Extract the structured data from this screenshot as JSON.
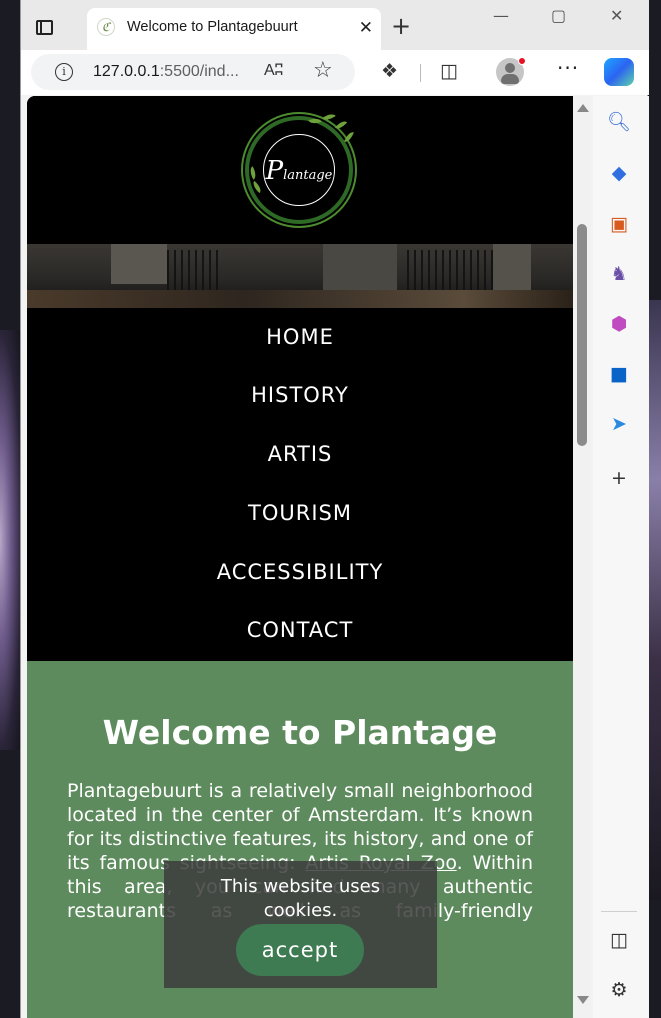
{
  "browser": {
    "tab_title": "Welcome to Plantagebuurt",
    "tab_favicon_glyph": "ℭ",
    "url_main": "127.0.0.1",
    "url_rest": ":5500/ind...",
    "read_aloud": "Aᶜ",
    "window_minimize": "—",
    "window_maximize": "▢",
    "window_close": "✕",
    "new_tab": "+",
    "tab_close": "✕",
    "more": "···"
  },
  "logo": {
    "brand_initial": "P",
    "brand_rest": "lantage"
  },
  "nav": {
    "items": [
      "HOME",
      "HISTORY",
      "ARTIS",
      "TOURISM",
      "ACCESSIBILITY",
      "CONTACT"
    ]
  },
  "welcome": {
    "title": "Welcome to Plantage",
    "text_before_link": "Plantagebuurt is a relatively small neighborhood located in the center of Amsterdam. It’s known for its distinctive features, its history, and one of its famous sightseeing: ",
    "link_text": "Artis Royal Zoo",
    "text_after_link": ". Within this area, you can find many authentic restaurants as well as family-friendly attractions."
  },
  "cookie": {
    "message": "This website uses cookies.",
    "button_label": "accept"
  },
  "colors": {
    "welcome_bg": "#5e8b5e",
    "accept_bg": "#3e7a52",
    "logo_green": "#4c8b2e"
  },
  "icons": {
    "sidebar": [
      "search-icon",
      "tag-icon",
      "toolbox-icon",
      "chess-icon",
      "office-icon",
      "outlook-icon",
      "send-icon",
      "add-icon"
    ],
    "sidebar_bottom": [
      "panel-icon",
      "settings-icon"
    ]
  }
}
